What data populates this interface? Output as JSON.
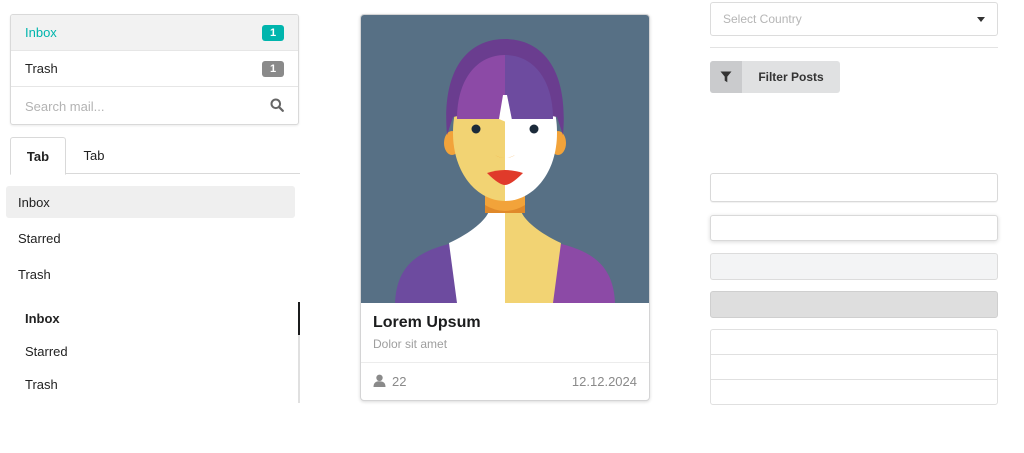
{
  "mail_menu": {
    "items": [
      {
        "label": "Inbox",
        "count": "1"
      },
      {
        "label": "Trash",
        "count": "1"
      }
    ],
    "search_placeholder": "Search mail..."
  },
  "tabs": [
    {
      "label": "Tab"
    },
    {
      "label": "Tab"
    }
  ],
  "vertical_menu": {
    "items": [
      {
        "label": "Inbox"
      },
      {
        "label": "Starred"
      },
      {
        "label": "Trash"
      }
    ]
  },
  "pointing_menu": {
    "items": [
      {
        "label": "Inbox"
      },
      {
        "label": "Starred"
      },
      {
        "label": "Trash"
      }
    ]
  },
  "card": {
    "header": "Lorem Upsum",
    "meta": "Dolor sit amet",
    "likes": "22",
    "date": "12.12.2024",
    "image_icon": "woman-avatar-illustration"
  },
  "filters": {
    "select_placeholder": "Select Country",
    "filter_button": "Filter Posts",
    "filter_icon": "filter-icon"
  },
  "colors": {
    "accent": "#00b5ad",
    "badge_grey": "#8a8a8a",
    "card_bg": "#577085"
  }
}
